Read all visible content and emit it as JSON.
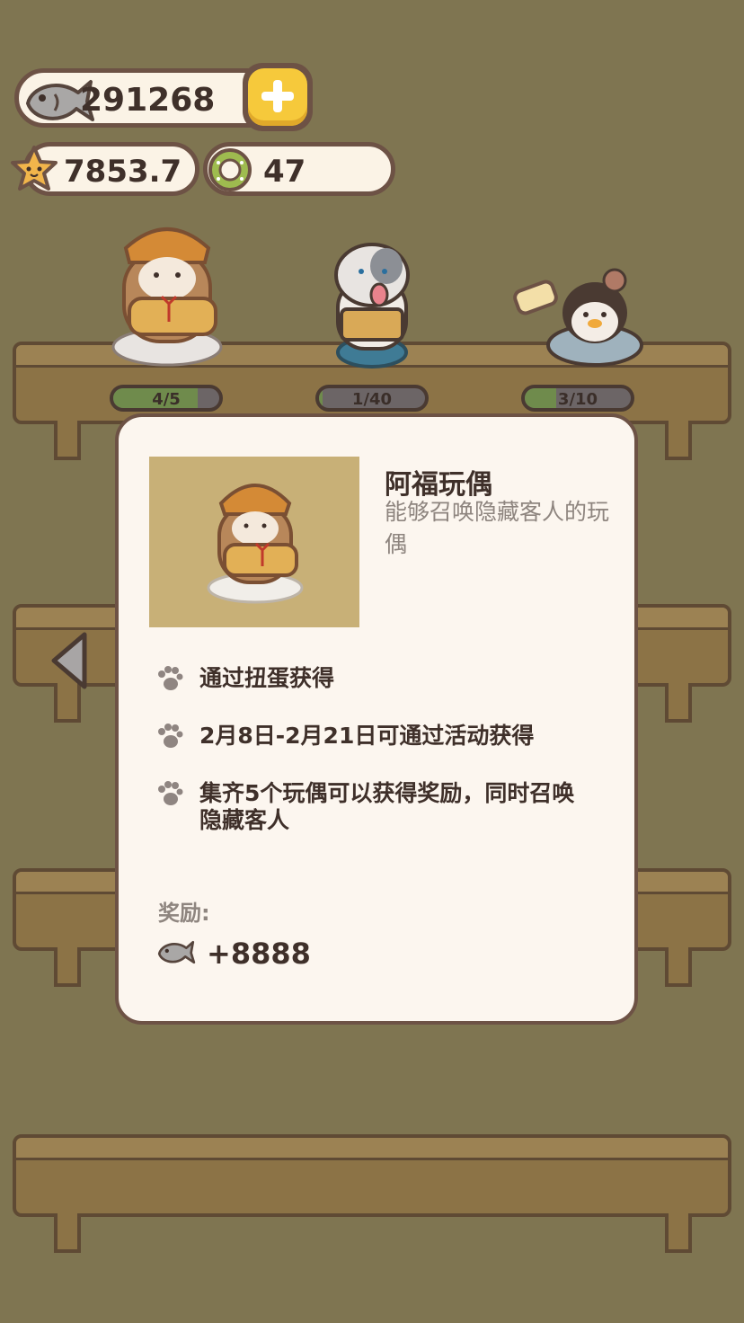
{
  "currency": {
    "fish": "291268",
    "stars": "7853.7",
    "tokens": "47"
  },
  "shelf_items": [
    {
      "name": "阿福玩偶",
      "progress_label": "4/5",
      "progress": 0.8
    },
    {
      "name": "",
      "progress_label": "1/40",
      "progress": 0.025
    },
    {
      "name": "",
      "progress_label": "3/10",
      "progress": 0.3
    }
  ],
  "modal": {
    "title": "阿福玩偶",
    "description": "能够召唤隐藏客人的玩偶",
    "info": [
      "通过扭蛋获得",
      "2月8日-2月21日可通过活动获得",
      "集齐5个玩偶可以获得奖励，同时召唤隐藏客人"
    ],
    "reward_label": "奖励:",
    "reward_value": "+8888"
  },
  "icons": [
    "fish-icon",
    "plus-icon",
    "star-icon",
    "green-token-icon",
    "paw-icon",
    "chevron-left-icon"
  ],
  "colors": {
    "accent": "#f6c93b",
    "panel": "#fcf6ef",
    "border": "#6d5245",
    "text": "#3f302a"
  }
}
